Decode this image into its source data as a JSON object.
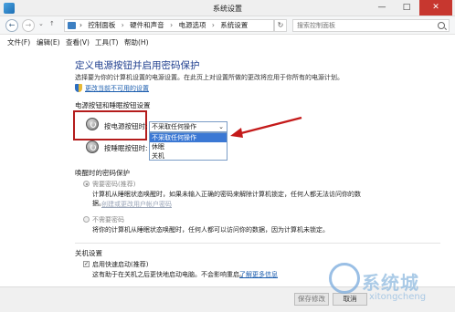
{
  "window": {
    "title": "系统设置",
    "controls": {
      "minimize": "—",
      "maximize": "□",
      "close": "✕"
    }
  },
  "address_bar": {
    "back": "←",
    "forward": "→",
    "recent": "⌄",
    "up": "↑",
    "breadcrumb": [
      "控制面板",
      "硬件和声音",
      "电源选项",
      "系统设置"
    ],
    "separator": "›",
    "refresh": "↻",
    "search_placeholder": "搜索控制面板"
  },
  "menu": [
    "文件(F)",
    "编辑(E)",
    "查看(V)",
    "工具(T)",
    "帮助(H)"
  ],
  "page": {
    "heading": "定义电源按钮并启用密码保护",
    "description": "选择要为你的计算机设置的电源设置。在此页上对设置所做的更改将应用于你所有的电源计划。",
    "change_settings_link": "更改当前不可用的设置",
    "power_sleep_section": "电源按钮和睡眠按钮设置",
    "power_button_label": "按电源按钮时:",
    "sleep_button_label": "按睡眠按钮时:",
    "power_button_value": "不采取任何操作",
    "dropdown_options": [
      "不采取任何操作",
      "休眠",
      "关机"
    ],
    "dropdown_selected_index": 0,
    "wakeup_section": "唤醒时的密码保护",
    "require_password_label": "需要密码(推荐)",
    "require_password_desc": "计算机从睡眠状态唤醒时，如果未输入正确的密码来解除计算机锁定，任何人都无法访问你的数",
    "require_password_desc2": "据。",
    "create_password_link": "创建或更改用户帐户密码",
    "no_password_label": "不需要密码",
    "no_password_desc": "将你的计算机从睡眠状态唤醒时，任何人都可以访问你的数据，因为计算机未锁定。",
    "shutdown_section": "关机设置",
    "fast_startup_label": "启用快速启动(推荐)",
    "fast_startup_checked": true,
    "fast_startup_desc": "这有助于在关机之后更快地启动电脑。不会影响重启。",
    "learn_more_link": "了解更多信息"
  },
  "buttons": {
    "save": "保存修改",
    "cancel": "取消"
  },
  "watermark": {
    "text": "系统城",
    "sub": "xitongcheng"
  },
  "colors": {
    "accent": "#1f3f8f",
    "highlight": "#3b78d4",
    "callout": "#b41c1c"
  }
}
